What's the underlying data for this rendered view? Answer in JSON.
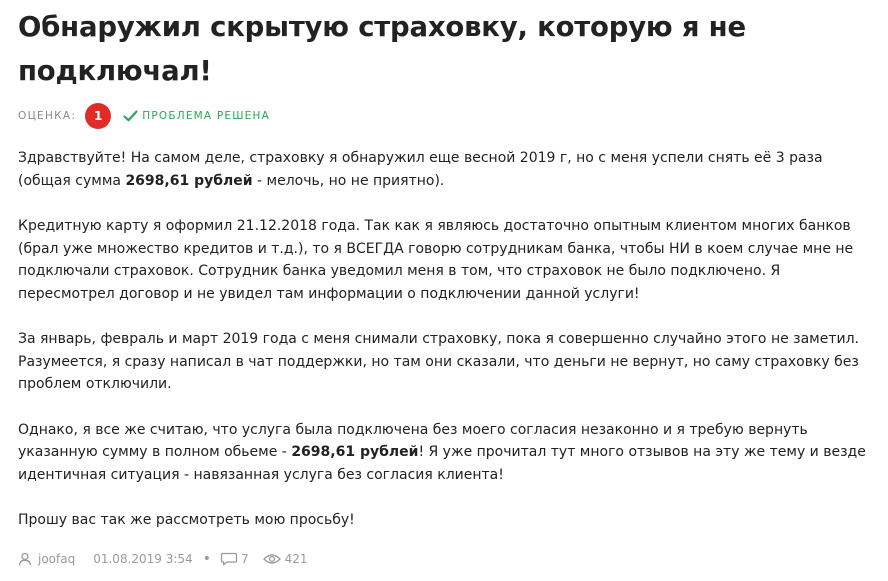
{
  "review": {
    "title": "Обнаружил скрытую страховку, которую я не подключал!",
    "rating_label": "ОЦЕНКА:",
    "rating_value": "1",
    "status_label": "ПРОБЛЕМА РЕШЕНА",
    "paragraphs": [
      {
        "p1_a": "Здравствуйте! На самом деле, страховку я обнаружил еще весной 2019 г, но с меня успели снять её 3 раза (общая сумма ",
        "p1_b": "2698,61 рублей",
        "p1_c": " - мелочь, но не приятно)."
      },
      {
        "text": "Кредитную карту я оформил 21.12.2018 года. Так как я являюсь достаточно опытным клиентом многих банков (брал уже множество кредитов и т.д.), то я ВСЕГДА говорю сотрудникам банка, чтобы НИ в коем случае мне не подключали страховок. Сотрудник банка уведомил меня в том, что страховок не было подключено. Я пересмотрел договор и не увидел там информации о подключении данной услуги!"
      },
      {
        "text": "За январь, февраль и март 2019 года с меня снимали страховку, пока я совершенно случайно этого не заметил. Разумеется, я сразу написал в чат поддержки, но там они сказали, что деньги не вернут, но саму страховку без проблем отключили."
      },
      {
        "p4_a": "Однако, я все же считаю, что услуга была подключена без моего согласия незаконно и я требую вернуть указанную сумму в полном обьеме - ",
        "p4_b": "2698,61 рублей",
        "p4_c": "! Я уже прочитал тут много отзывов на эту же тему и везде идентичная ситуация - навязанная услуга без согласия клиента!"
      },
      {
        "text": "Прошу вас так же рассмотреть мою просьбу!"
      }
    ]
  },
  "footer": {
    "author": "joofaq",
    "date": "01.08.2019 3:54",
    "separator": "•",
    "comments_count": "7",
    "views_count": "421"
  },
  "icons": {
    "check": "check-icon",
    "user": "user-icon",
    "comment": "comment-icon",
    "views": "eye-icon"
  },
  "colors": {
    "rating_badge": "#e02b27",
    "status": "#2aa850",
    "meta_text": "#9a9a9a",
    "body_text": "#222222"
  }
}
